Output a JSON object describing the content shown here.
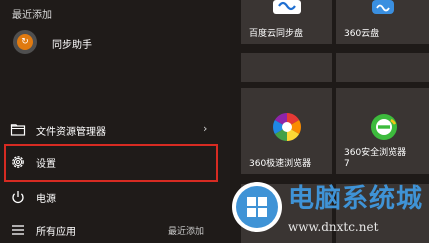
{
  "start_menu": {
    "recently_added_header": "最近添加",
    "recent_apps": [
      {
        "label": "同步助手",
        "icon": "tongbu-app-icon"
      }
    ],
    "menu_items": [
      {
        "label": "文件资源管理器",
        "icon": "folder-icon",
        "has_submenu": true
      },
      {
        "label": "设置",
        "icon": "gear-icon",
        "highlighted": true
      },
      {
        "label": "电源",
        "icon": "power-icon"
      },
      {
        "label": "所有应用",
        "icon": "list-icon"
      }
    ],
    "footer_recent_label": "最近添加"
  },
  "tiles": [
    {
      "label": "百度云同步盘",
      "icon": "baidu-cloud-icon"
    },
    {
      "label": "360云盘",
      "icon": "360-cloud-icon"
    },
    {
      "label": "360极速浏览器",
      "icon": "360-speed-browser-icon"
    },
    {
      "label": "360安全浏览器\n7",
      "icon": "360-safe-browser-icon"
    }
  ],
  "watermark": {
    "title": "电脑系统城",
    "url": "www.dnxtc.net"
  },
  "colors": {
    "background": "#1e1a18",
    "tile": "#3a3533",
    "highlight": "#d72b22",
    "watermark_blue": "#3f93d6"
  }
}
